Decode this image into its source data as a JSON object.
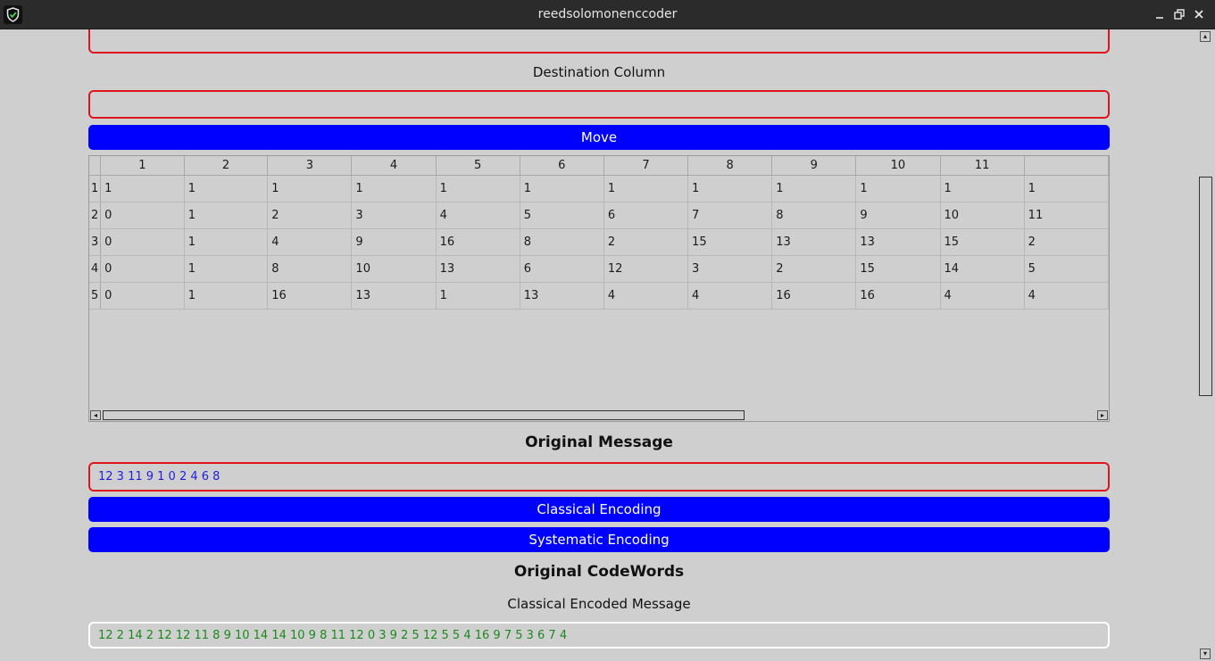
{
  "window": {
    "title": "reedsolomonenccoder"
  },
  "destination": {
    "label": "Destination Column",
    "value": ""
  },
  "move_button": "Move",
  "matrix": {
    "column_headers": [
      "1",
      "2",
      "3",
      "4",
      "5",
      "6",
      "7",
      "8",
      "9",
      "10",
      "11",
      ""
    ],
    "rows": [
      {
        "header": "1",
        "cells": [
          "1",
          "1",
          "1",
          "1",
          "1",
          "1",
          "1",
          "1",
          "1",
          "1",
          "1",
          "1"
        ]
      },
      {
        "header": "2",
        "cells": [
          "0",
          "1",
          "2",
          "3",
          "4",
          "5",
          "6",
          "7",
          "8",
          "9",
          "10",
          "11"
        ]
      },
      {
        "header": "3",
        "cells": [
          "0",
          "1",
          "4",
          "9",
          "16",
          "8",
          "2",
          "15",
          "13",
          "13",
          "15",
          "2"
        ]
      },
      {
        "header": "4",
        "cells": [
          "0",
          "1",
          "8",
          "10",
          "13",
          "6",
          "12",
          "3",
          "2",
          "15",
          "14",
          "5"
        ]
      },
      {
        "header": "5",
        "cells": [
          "0",
          "1",
          "16",
          "13",
          "1",
          "13",
          "4",
          "4",
          "16",
          "16",
          "4",
          "4"
        ]
      }
    ]
  },
  "original_message": {
    "heading": "Original Message",
    "value": "12 3 11 9 1 0 2 4 6 8"
  },
  "buttons": {
    "classical": "Classical Encoding",
    "systematic": "Systematic Encoding"
  },
  "codewords": {
    "heading": "Original CodeWords",
    "classical_label": "Classical Encoded Message",
    "classical_value": "12 2 14 2 12 12 11 8 9 10 14 14 10 9 8 11 12 0 3 9 2 5 12 5 5 4 16 9 7 5 3 6 7 4"
  },
  "icons": {
    "app": "shield-check-icon",
    "minimize": "minimize-icon",
    "restore": "restore-icon",
    "close": "close-icon"
  },
  "colors": {
    "accent": "#0000ff",
    "field_border": "#e0141c",
    "message_text": "#1e1ee0",
    "codeword_text": "#1a8a1a"
  }
}
